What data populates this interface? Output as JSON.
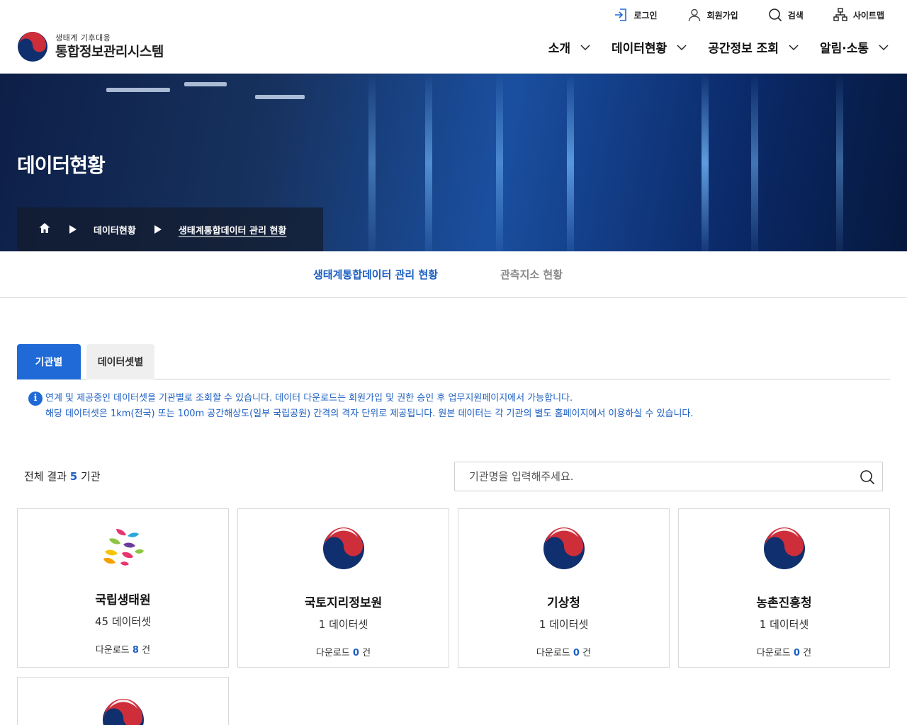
{
  "header": {
    "logo_sub": "생태계 기후대응",
    "logo_main": "통합정보관리시스템",
    "util": [
      {
        "label": "로그인",
        "icon": "login-icon"
      },
      {
        "label": "회원가입",
        "icon": "user-icon"
      },
      {
        "label": "검색",
        "icon": "search-icon"
      },
      {
        "label": "사이트맵",
        "icon": "sitemap-icon"
      }
    ],
    "nav": [
      {
        "label": "소개"
      },
      {
        "label": "데이터현황"
      },
      {
        "label": "공간정보 조회"
      },
      {
        "label": "알림·소통"
      }
    ]
  },
  "hero": {
    "title": "데이터현황",
    "breadcrumb": [
      "데이터현황",
      "생태계통합데이터 관리 현황"
    ]
  },
  "subtabs": [
    {
      "label": "생태계통합데이터 관리 현황",
      "active": true
    },
    {
      "label": "관측지소 현황",
      "active": false
    }
  ],
  "content_tabs": [
    {
      "label": "기관별",
      "active": true
    },
    {
      "label": "데이터셋별",
      "active": false
    }
  ],
  "notice": {
    "icon_glyph": "i",
    "lines": [
      "연계 및 제공중인 데이터셋을 기관별로 조회할 수 있습니다. 데이터 다운로드는 회원가입 및 권한 승인 후 업무지원페이지에서 가능합니다.",
      "해당 데이터셋은 1km(전국) 또는 100m 공간해상도(일부 국립공원) 간격의 격자 단위로 제공됩니다. 원본 데이터는 각 기관의 별도 홈페이지에서 이용하실 수 있습니다."
    ]
  },
  "result": {
    "prefix": "전체 결과",
    "count": "5",
    "suffix": "기관"
  },
  "search": {
    "placeholder": "기관명을 입력해주세요."
  },
  "cards": [
    {
      "name": "국립생태원",
      "count": "45",
      "count_unit": "데이터셋",
      "dl_label": "다운로드",
      "dl_count": "8",
      "dl_unit": "건",
      "logo": "nie-leaf-logo"
    },
    {
      "name": "국토지리정보원",
      "count": "1",
      "count_unit": "데이터셋",
      "dl_label": "다운로드",
      "dl_count": "0",
      "dl_unit": "건",
      "logo": "taegeuk-logo"
    },
    {
      "name": "기상청",
      "count": "1",
      "count_unit": "데이터셋",
      "dl_label": "다운로드",
      "dl_count": "0",
      "dl_unit": "건",
      "logo": "taegeuk-logo"
    },
    {
      "name": "농촌진흥청",
      "count": "1",
      "count_unit": "데이터셋",
      "dl_label": "다운로드",
      "dl_count": "0",
      "dl_unit": "건",
      "logo": "taegeuk-logo"
    },
    {
      "name": "",
      "count": "",
      "count_unit": "",
      "dl_label": "",
      "dl_count": "",
      "dl_unit": "",
      "logo": "taegeuk-logo"
    }
  ],
  "colors": {
    "accent": "#1f6ad6",
    "accent_text": "#1d5fc2",
    "taegeuk_red": "#cd2e3a",
    "taegeuk_blue": "#0f2f6e"
  }
}
